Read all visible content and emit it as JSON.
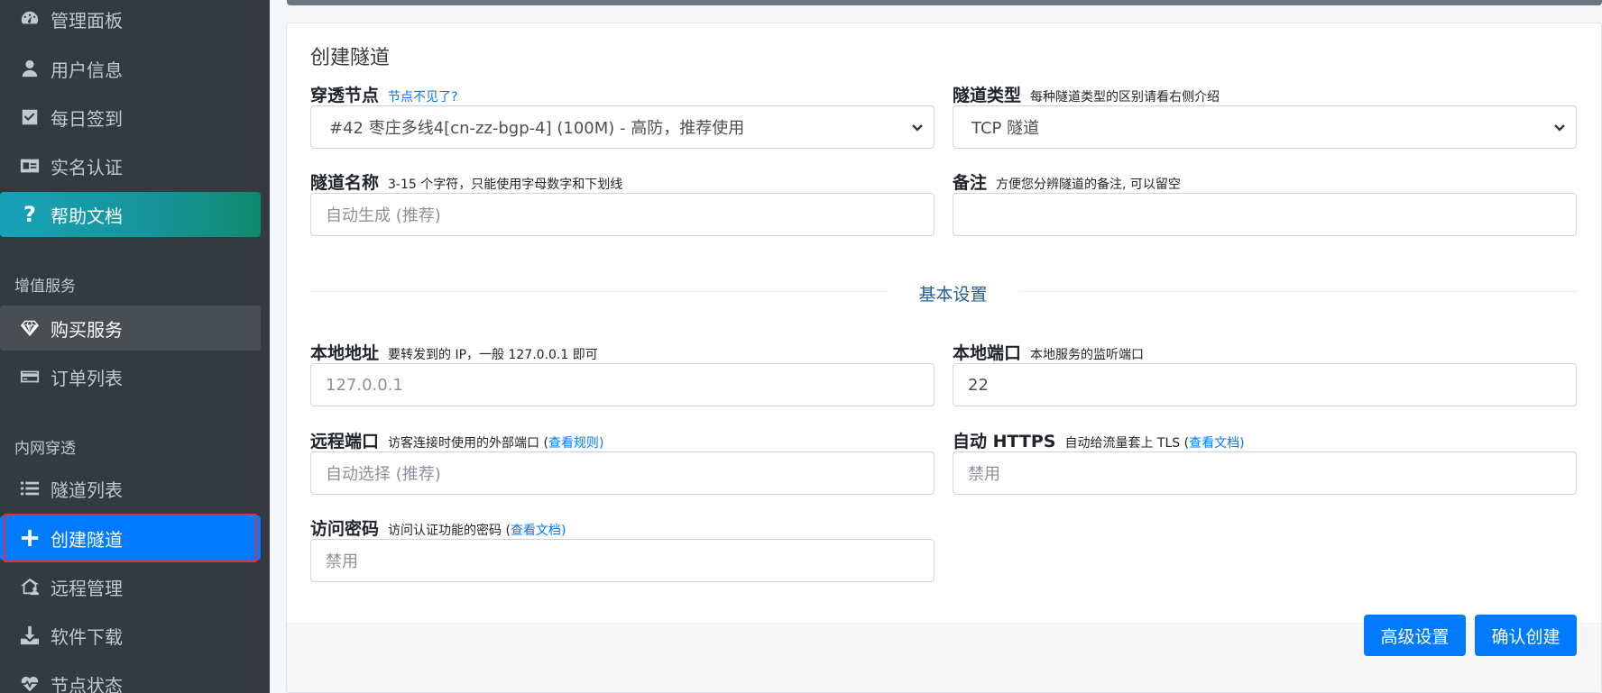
{
  "sidebar": {
    "items": [
      {
        "label": "管理面板",
        "icon": "dashboard-gauge-icon"
      },
      {
        "label": "用户信息",
        "icon": "user-icon"
      },
      {
        "label": "每日签到",
        "icon": "check-square-icon"
      },
      {
        "label": "实名认证",
        "icon": "id-card-icon"
      },
      {
        "label": "帮助文档",
        "icon": "question-icon"
      },
      {
        "label": "购买服务",
        "icon": "diamond-icon"
      },
      {
        "label": "订单列表",
        "icon": "credit-card-icon"
      },
      {
        "label": "隧道列表",
        "icon": "list-icon"
      },
      {
        "label": "创建隧道",
        "icon": "plus-icon"
      },
      {
        "label": "远程管理",
        "icon": "house-user-icon"
      },
      {
        "label": "软件下载",
        "icon": "download-icon"
      },
      {
        "label": "节点状态",
        "icon": "heartbeat-icon"
      }
    ],
    "headers": {
      "value_added": "增值服务",
      "intranet": "内网穿透"
    }
  },
  "form": {
    "title": "创建隧道",
    "node": {
      "label": "穿透节点",
      "link": "节点不见了?",
      "value": "#42 枣庄多线4[cn-zz-bgp-4] (100M) - 高防，推荐使用"
    },
    "tunnel_type": {
      "label": "隧道类型",
      "hint": "每种隧道类型的区别请看右侧介绍",
      "value": "TCP 隧道"
    },
    "tunnel_name": {
      "label": "隧道名称",
      "hint": "3-15 个字符，只能使用字母数字和下划线",
      "placeholder": "自动生成 (推荐)"
    },
    "remark": {
      "label": "备注",
      "hint": "方便您分辨隧道的备注, 可以留空",
      "value": ""
    },
    "section_basic": "基本设置",
    "local_addr": {
      "label": "本地地址",
      "hint": "要转发到的 IP，一般 127.0.0.1 即可",
      "placeholder": "127.0.0.1"
    },
    "local_port": {
      "label": "本地端口",
      "hint": "本地服务的监听端口",
      "value": "22"
    },
    "remote_port": {
      "label": "远程端口",
      "hint": "访客连接时使用的外部端口 (",
      "link": "查看规则",
      "hint_end": ")",
      "placeholder": "自动选择 (推荐)"
    },
    "auto_https": {
      "label": "自动 HTTPS",
      "hint": "自动给流量套上 TLS (",
      "link": "查看文档",
      "hint_end": ")",
      "placeholder": "禁用"
    },
    "access_password": {
      "label": "访问密码",
      "hint": "访问认证功能的密码 (",
      "link": "查看文档",
      "hint_end": ")",
      "placeholder": "禁用"
    }
  },
  "buttons": {
    "advanced": "高级设置",
    "confirm": "确认创建"
  },
  "colors": {
    "sidebar_bg": "#343a40",
    "primary": "#007bff",
    "highlight_outline": "#e0303a"
  }
}
